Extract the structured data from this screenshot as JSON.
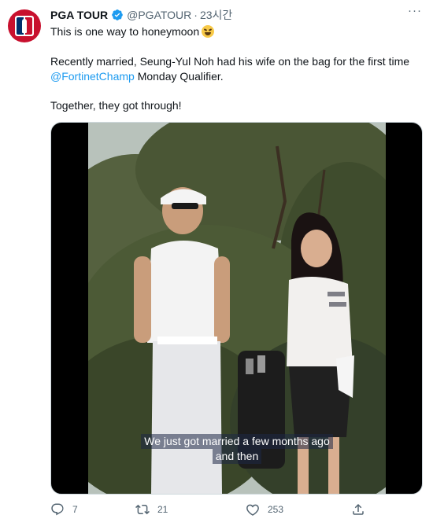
{
  "tweet": {
    "author_name": "PGA TOUR",
    "handle": "@PGATOUR",
    "separator": "·",
    "time": "23시간",
    "more_label": "···",
    "line1": "This is one way to honeymoon",
    "line2_before": "Recently married, Seung-Yul Noh had his wife on the bag for the first time ",
    "mention": "@FortinetChamp",
    "line2_after": " Monday Qualifier.",
    "line3": "Together, they got through!",
    "emoji_icon": "rofl-emoji-icon",
    "verified_icon": "verified-badge-icon",
    "brand_color": "#c8102e",
    "link_color": "#1d9bf0"
  },
  "media": {
    "subtitle_line1": "We just got married a few months ago",
    "subtitle_line2": "and then"
  },
  "actions": {
    "replies": "7",
    "retweets": "21",
    "likes": "253",
    "reply_icon": "reply-icon",
    "retweet_icon": "retweet-icon",
    "like_icon": "heart-icon",
    "share_icon": "share-icon"
  }
}
